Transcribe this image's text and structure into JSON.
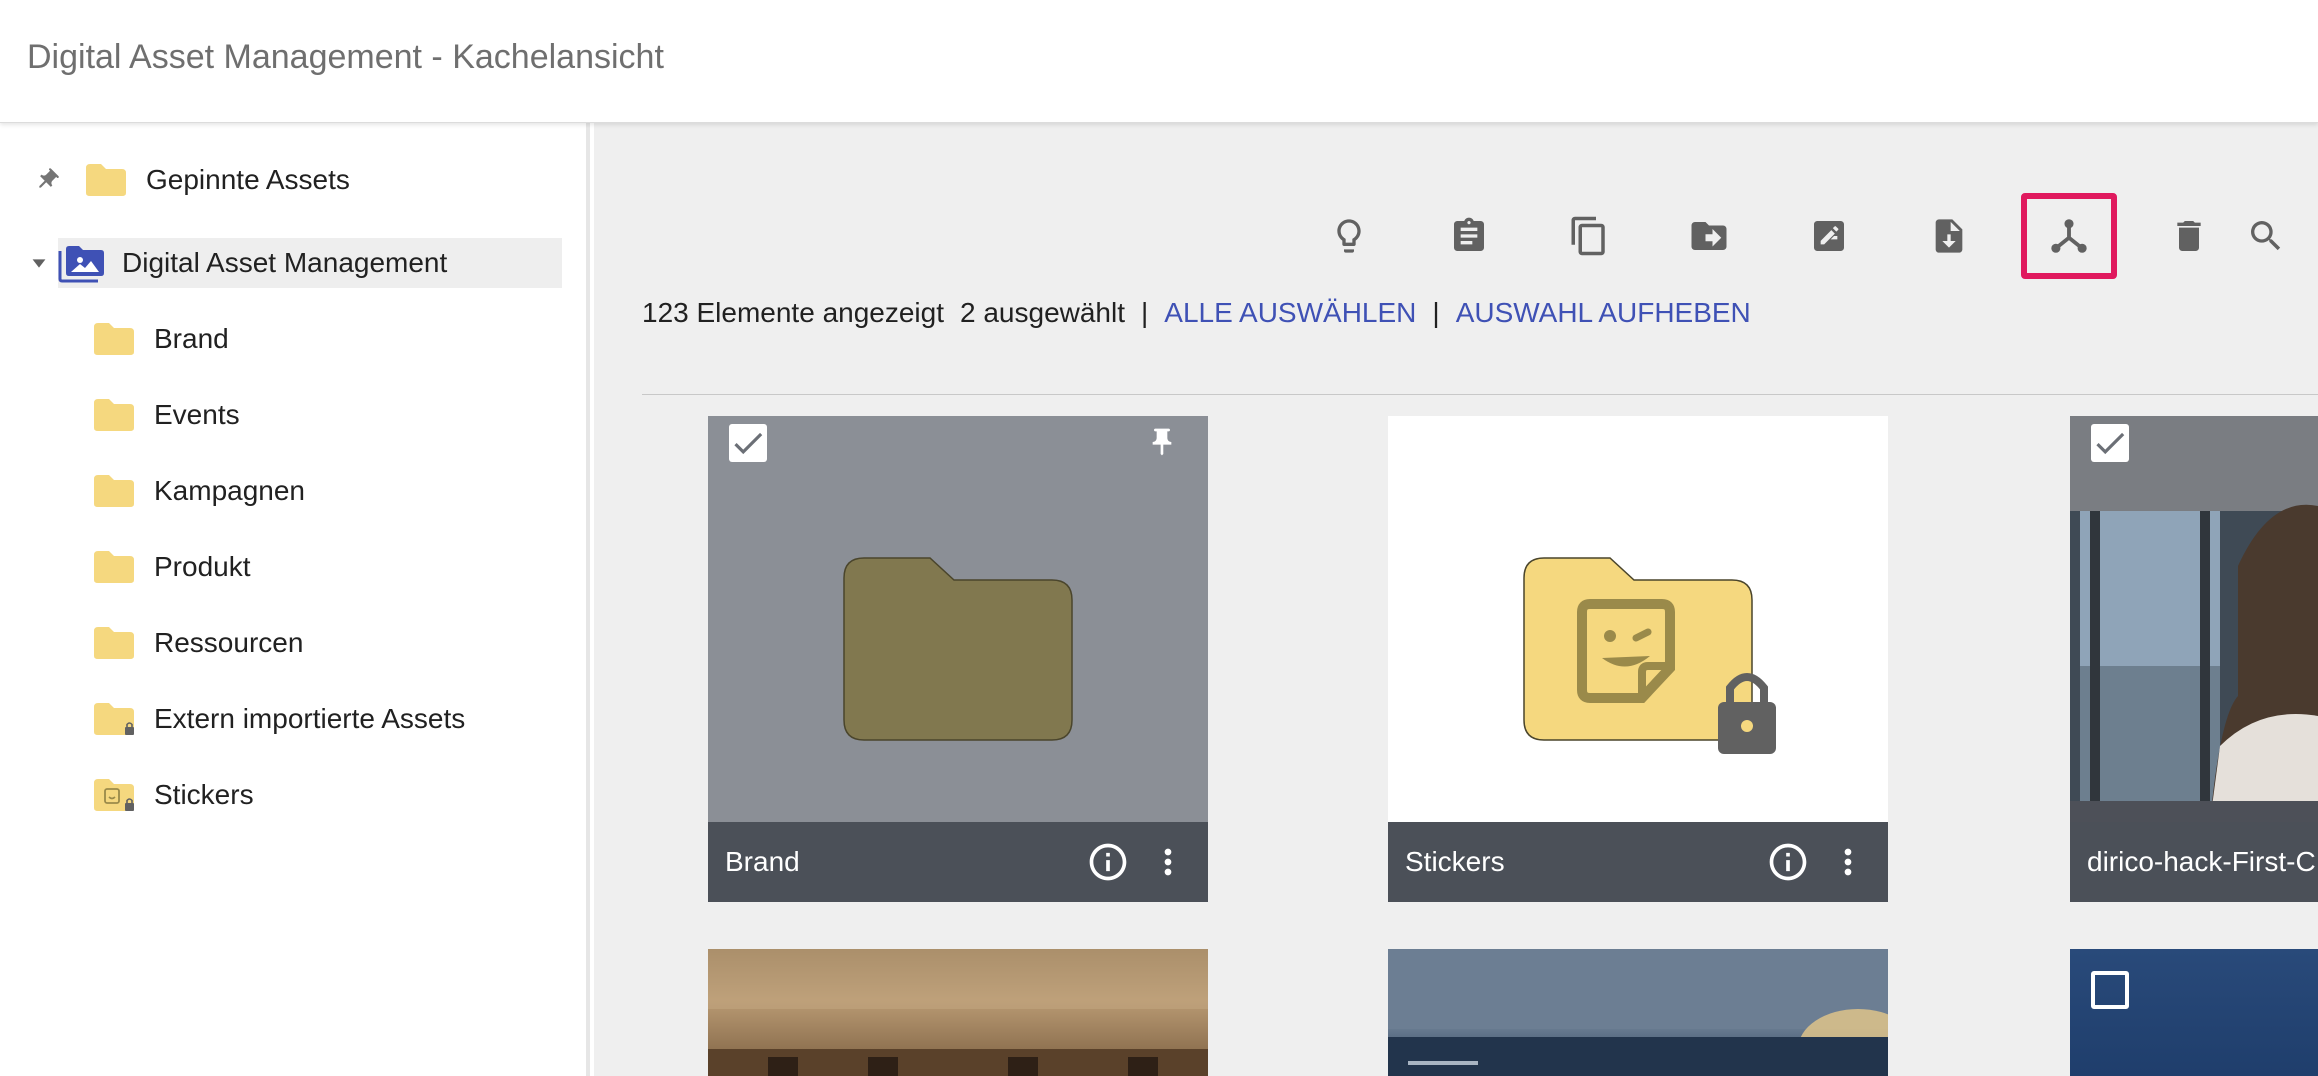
{
  "header": {
    "title": "Digital Asset Management - Kachelansicht"
  },
  "sidebar": {
    "pinned": {
      "label": "Gepinnte Assets"
    },
    "root": {
      "label": "Digital Asset Management"
    },
    "items": [
      {
        "label": "Brand"
      },
      {
        "label": "Events"
      },
      {
        "label": "Kampagnen"
      },
      {
        "label": "Produkt"
      },
      {
        "label": "Ressourcen"
      },
      {
        "label": "Extern importierte Assets"
      },
      {
        "label": "Stickers"
      }
    ]
  },
  "toolbar": {
    "icons": [
      "lightbulb-icon",
      "clipboard-icon",
      "copy-icon",
      "move-folder-icon",
      "edit-icon",
      "download-file-icon",
      "share-icon",
      "delete-icon",
      "search-icon"
    ],
    "highlighted": "share-icon",
    "highlight_color": "#e0195e"
  },
  "status": {
    "shown": "123 Elemente angezeigt",
    "selected": "2 ausgewählt",
    "separator": "|",
    "select_all": "ALLE AUSWÄHLEN",
    "clear_selection": "AUSWAHL AUFHEBEN"
  },
  "tiles": [
    {
      "name": "Brand",
      "checked": true,
      "pinned": true
    },
    {
      "name": "Stickers",
      "checked": false,
      "locked": true
    },
    {
      "name": "dirico-hack-First-C",
      "checked": true
    }
  ],
  "colors": {
    "link": "#3f51b5",
    "folder": "#f5d87f",
    "folder_dark": "#81784f",
    "tile_footer": "#4b5058",
    "root_icon": "#3f51b5"
  }
}
